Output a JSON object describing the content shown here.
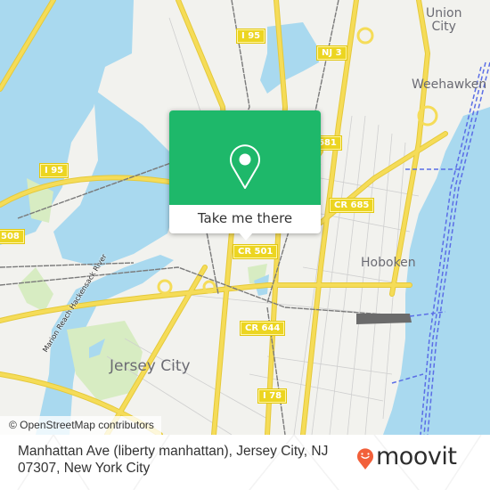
{
  "map": {
    "colors": {
      "land": "#f2f2ee",
      "water": "#a9d9ef",
      "park": "#d7ecc2",
      "road": "#f5dc58",
      "road_edge": "#e5c93a",
      "rail": "#7a7a7a",
      "ferry": "#5b6ee6",
      "street": "#cfcfcf"
    },
    "place_labels": [
      {
        "id": "union-city",
        "text": "Union\nCity"
      },
      {
        "id": "weehawken",
        "text": "Weehawken"
      },
      {
        "id": "hoboken",
        "text": "Hoboken"
      },
      {
        "id": "jersey-city",
        "text": "Jersey City"
      }
    ],
    "river_label": "Marion Reach Hackensack River",
    "road_shields": [
      {
        "id": "i95-north",
        "text": "I 95"
      },
      {
        "id": "nj3",
        "text": "NJ 3"
      },
      {
        "id": "i95-west",
        "text": "I 95"
      },
      {
        "id": "cr681",
        "text": "681"
      },
      {
        "id": "cr685",
        "text": "CR 685"
      },
      {
        "id": "cr508",
        "text": "508"
      },
      {
        "id": "cr501",
        "text": "CR 501"
      },
      {
        "id": "cr644",
        "text": "CR 644"
      },
      {
        "id": "i78",
        "text": "I 78"
      }
    ],
    "attribution": "© OpenStreetMap contributors"
  },
  "popup": {
    "icon": "location-pin-icon",
    "button_label": "Take me there",
    "accent_color": "#1eb86a"
  },
  "footer": {
    "address": "Manhattan Ave (liberty manhattan), Jersey City, NJ 07307, New York City",
    "logo_text": "moovit",
    "logo_color": "#f2603a"
  }
}
